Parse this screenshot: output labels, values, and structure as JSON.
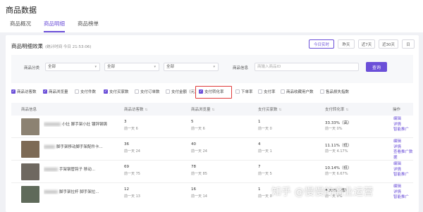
{
  "page": {
    "title": "商品数据"
  },
  "tabs": [
    "商品概况",
    "商品明细",
    "商品榜单"
  ],
  "section": {
    "title": "商品明细效果",
    "subtitle": "(统计时间 今日 21:53:06)"
  },
  "time_buttons": [
    "今日实时",
    "昨天",
    "近7天",
    "近30天",
    "日"
  ],
  "filters": {
    "category_label": "商品分类",
    "selects": [
      "全部",
      "全部",
      "全部"
    ],
    "info_label": "商品信息",
    "info_placeholder": "商输入商品ID",
    "query_button": "查询"
  },
  "metric_checks": [
    {
      "label": "商品访客数",
      "checked": true
    },
    {
      "label": "商品浏览量",
      "checked": true
    },
    {
      "label": "支付件数",
      "checked": false
    },
    {
      "label": "支付买家数",
      "checked": true
    },
    {
      "label": "支付订单数",
      "checked": false
    },
    {
      "label": "支付金额（元）",
      "checked": false
    },
    {
      "label": "支付转化率",
      "checked": true
    },
    {
      "label": "下单率",
      "checked": false
    },
    {
      "label": "支付率",
      "checked": false
    },
    {
      "label": "商品收藏用户数",
      "checked": false
    },
    {
      "label": "售品损失指数",
      "checked": false
    }
  ],
  "columns": [
    "商品信息",
    "商品访客数",
    "商品浏览量",
    "支付买家数",
    "支付转化率",
    "操作"
  ],
  "rows": [
    {
      "title": "小灶 脚手架小灶 镀锌钢铸",
      "visitors": "3",
      "visitors_cmp": "前一天 6",
      "views": "5",
      "views_cmp": "前一天 6",
      "buyers": "1",
      "buyers_cmp": "前一天 0",
      "conv": "33.33%（高）",
      "conv_cmp": "前一天 0%",
      "thumb_color": "#8c8272"
    },
    {
      "title": "脚手架移动脚手架配件卡...",
      "visitors": "36",
      "visitors_cmp": "前一天 24",
      "views": "40",
      "views_cmp": "前一天 24",
      "buyers": "4",
      "buyers_cmp": "前一天 1",
      "conv": "11.11%（低）",
      "conv_cmp": "前一天 4.17%",
      "thumb_color": "#7d6a55"
    },
    {
      "title": "手架钢管钩子 移动...",
      "visitors": "69",
      "visitors_cmp": "前一天 75",
      "views": "78",
      "views_cmp": "前一天 85",
      "buyers": "7",
      "buyers_cmp": "前一天 5",
      "conv": "10.14%（低）",
      "conv_cmp": "前一天 6.67%",
      "thumb_color": "#6e6860"
    },
    {
      "title": "脚手架拉杆 脚手架拉...",
      "visitors": "12",
      "visitors_cmp": "前一天 13",
      "views": "16",
      "views_cmp": "前一天 14",
      "buyers": "1",
      "buyers_cmp": "前一天 0",
      "conv": "8.33%（低）",
      "conv_cmp": "前一天 0%",
      "thumb_color": "#5f6a5a"
    }
  ],
  "row_ops": [
    "编辑",
    "详情",
    "智能推广"
  ],
  "row_ops_alt": [
    "编辑",
    "详情",
    "查看推广数据"
  ],
  "watermark": "知乎 @慢慢的商业运营"
}
